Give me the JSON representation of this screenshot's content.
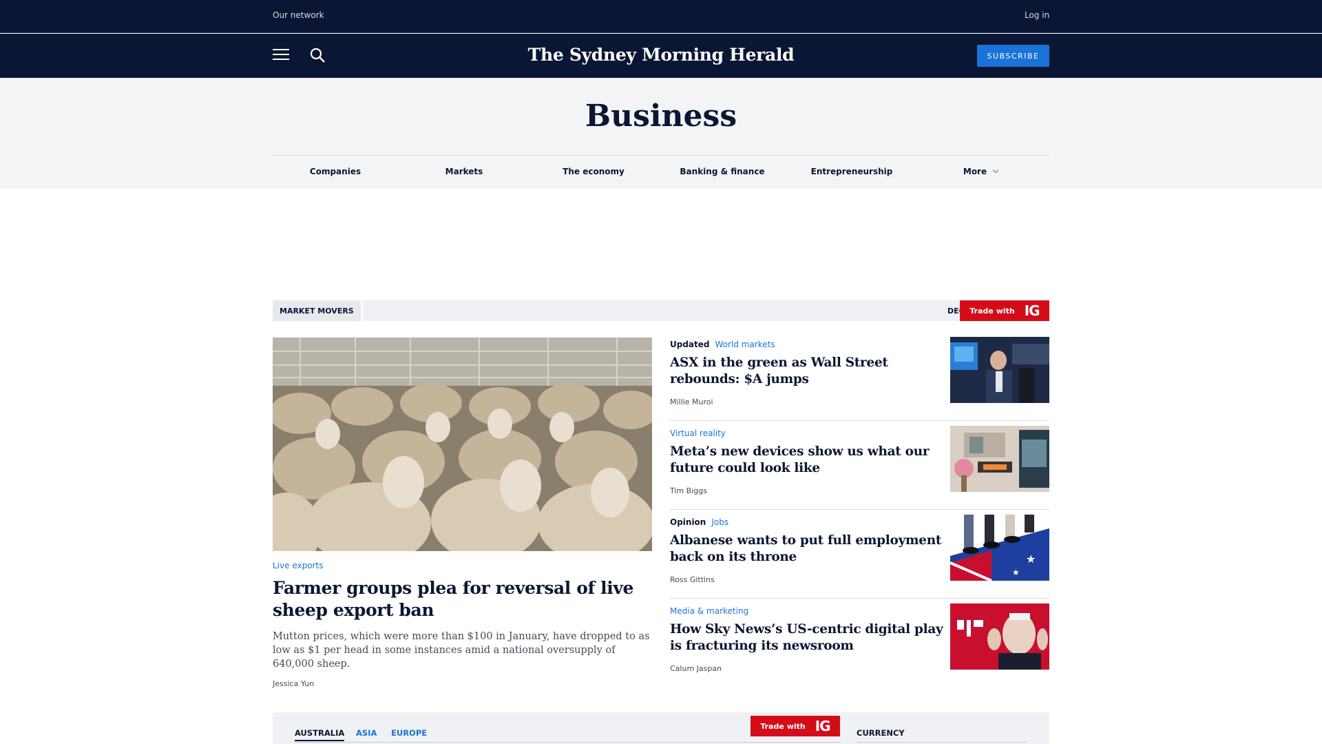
{
  "topbar": {
    "network": "Our network",
    "login": "Log in"
  },
  "masthead": {
    "logo": "The Sydney Morning Herald",
    "subscribe": "SUBSCRIBE"
  },
  "section": {
    "title": "Business",
    "nav": [
      "Companies",
      "Markets",
      "The economy",
      "Banking & finance",
      "Entrepreneurship",
      "More"
    ]
  },
  "market_movers": {
    "label": "MARKET MOVERS",
    "ticker": "DEC",
    "ig_text": "Trade with",
    "ig_logo": "IG"
  },
  "lead": {
    "kicker": "Live exports",
    "headline": "Farmer groups plea for reversal of live sheep export ban",
    "summary": "Mutton prices, which were more than $100 in January, have dropped to as low as $1 per head in some instances amid a national oversupply of 640,000 sheep.",
    "byline": "Jessica Yun"
  },
  "stories": [
    {
      "tag": "Updated",
      "kicker": "World markets",
      "headline": "ASX in the green as Wall Street rebounds: $A jumps",
      "byline": "Millie Muroi"
    },
    {
      "tag": "",
      "kicker": "Virtual reality",
      "headline": "Meta’s new devices show us what our future could look like",
      "byline": "Tim Biggs"
    },
    {
      "tag": "Opinion",
      "kicker": "Jobs",
      "headline": "Albanese wants to put full employment back on its throne",
      "byline": "Ross Gittins"
    },
    {
      "tag": "",
      "kicker": "Media & marketing",
      "headline": "How Sky News’s US-centric digital play is fracturing its newsroom",
      "byline": "Calum Jaspan"
    }
  ],
  "markets_panel": {
    "tabs": [
      "AUSTRALIA",
      "ASIA",
      "EUROPE"
    ],
    "ig_text": "Trade with",
    "ig_logo": "IG",
    "currency": "CURRENCY"
  },
  "colors": {
    "navy": "#0a1633",
    "accent_blue": "#1a73d9",
    "ig_red": "#d40c1a"
  }
}
